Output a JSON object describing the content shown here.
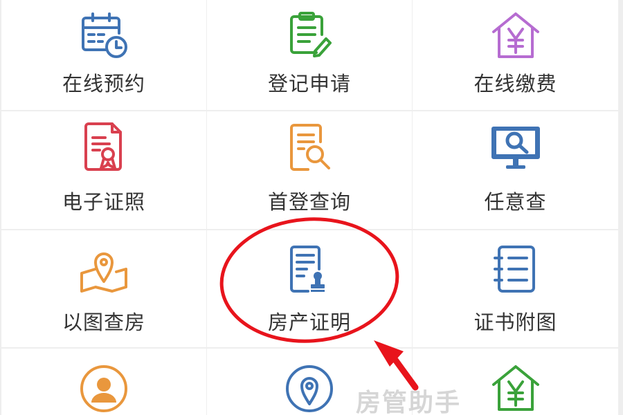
{
  "colors": {
    "blue": "#3f73b4",
    "green": "#3aa23a",
    "purple": "#b66cd1",
    "red": "#d9404f",
    "orange": "#e9973d",
    "annotation_red": "#e8141c"
  },
  "services": [
    {
      "label": "在线预约",
      "icon": "calendar-clock-icon"
    },
    {
      "label": "登记申请",
      "icon": "clipboard-edit-icon"
    },
    {
      "label": "在线缴费",
      "icon": "house-yen-icon"
    },
    {
      "label": "电子证照",
      "icon": "certificate-icon"
    },
    {
      "label": "首登查询",
      "icon": "document-search-icon"
    },
    {
      "label": "任意查",
      "icon": "monitor-search-icon"
    },
    {
      "label": "以图查房",
      "icon": "map-pin-icon"
    },
    {
      "label": "房产证明",
      "icon": "document-stamp-icon"
    },
    {
      "label": "证书附图",
      "icon": "notebook-list-icon"
    },
    {
      "label": "",
      "icon": "user-circle-icon"
    },
    {
      "label": "",
      "icon": "location-circle-icon"
    },
    {
      "label": "",
      "icon": "house-yen-icon"
    }
  ],
  "watermark": "房管助手"
}
